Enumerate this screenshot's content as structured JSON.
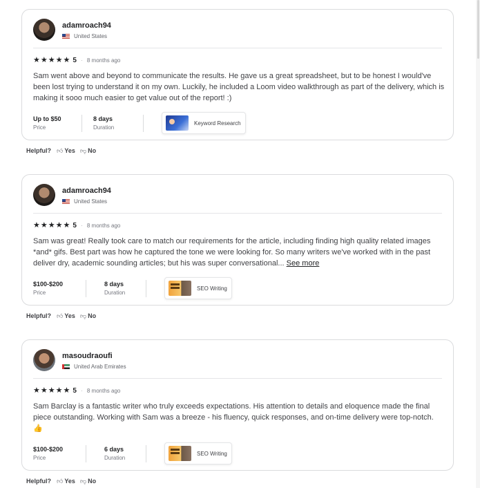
{
  "helpful": {
    "question": "Helpful?",
    "yes": "Yes",
    "no": "No"
  },
  "reviews": [
    {
      "username": "adamroach94",
      "country": "United States",
      "stars": "★★★★★",
      "rating": "5",
      "separator": "·",
      "time": "8 months ago",
      "text": "Sam went above and beyond to communicate the results. He gave us a great spreadsheet, but to be honest I would've been lost trying to understand it on my own. Luckily, he included a Loom video walkthrough as part of the delivery, which is making it sooo much easier to get value out of the report! :)",
      "see_more": "",
      "price_value": "Up to $50",
      "price_label": "Price",
      "duration_value": "8 days",
      "duration_label": "Duration",
      "gig_title": "Keyword Research"
    },
    {
      "username": "adamroach94",
      "country": "United States",
      "stars": "★★★★★",
      "rating": "5",
      "separator": "·",
      "time": "8 months ago",
      "text": "Sam was great! Really took care to match our requirements for the article, including finding high quality related images *and* gifs. Best part was how he captured the tone we were looking for. So many writers we've worked with in the past deliver dry, academic sounding articles; but his was super conversational...",
      "see_more": "See more",
      "price_value": "$100-$200",
      "price_label": "Price",
      "duration_value": "8 days",
      "duration_label": "Duration",
      "gig_title": "SEO Writing"
    },
    {
      "username": "masoudraoufi",
      "country": "United Arab Emirates",
      "stars": "★★★★★",
      "rating": "5",
      "separator": "·",
      "time": "8 months ago",
      "text": "Sam Barclay is a fantastic writer who truly exceeds expectations. His attention to details and eloquence made the final piece outstanding. Working with Sam was a breeze - his fluency, quick responses, and on-time delivery were top-notch. 👍",
      "see_more": "",
      "price_value": "$100-$200",
      "price_label": "Price",
      "duration_value": "6 days",
      "duration_label": "Duration",
      "gig_title": "SEO Writing"
    }
  ]
}
